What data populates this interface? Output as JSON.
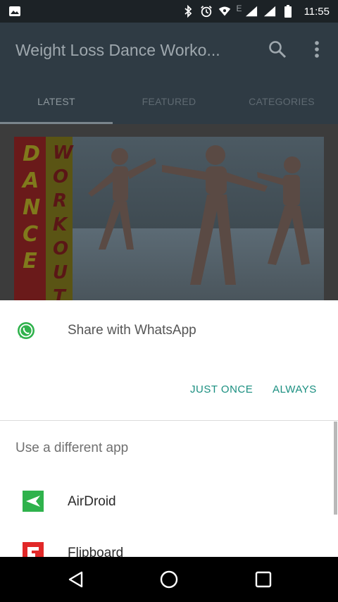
{
  "status_bar": {
    "time": "11:55",
    "network_label": "E",
    "icons": [
      "image-notification-icon",
      "bluetooth-icon",
      "alarm-icon",
      "wifi-icon",
      "signal-icon",
      "signal-icon",
      "battery-icon"
    ]
  },
  "app_bar": {
    "title": "Weight Loss Dance Worko...",
    "tabs": [
      {
        "label": "LATEST"
      },
      {
        "label": "FEATURED"
      },
      {
        "label": "CATEGORIES"
      }
    ],
    "active_tab": "LATEST"
  },
  "thumbnail": {
    "banner_left": "DANCE",
    "banner_right": "WORKOUT"
  },
  "share_sheet": {
    "share_title": "Share with WhatsApp",
    "just_once_label": "JUST ONCE",
    "always_label": "ALWAYS",
    "different_app_label": "Use a different app",
    "apps": [
      {
        "label": "AirDroid",
        "icon": "airdroid-icon",
        "color": "#2fb24c"
      },
      {
        "label": "Flipboard",
        "icon": "flipboard-icon",
        "color": "#e12828"
      }
    ],
    "accent_color": "#1a8f80"
  },
  "nav_bar": {
    "icons": [
      "back-icon",
      "home-icon",
      "recents-icon"
    ]
  }
}
